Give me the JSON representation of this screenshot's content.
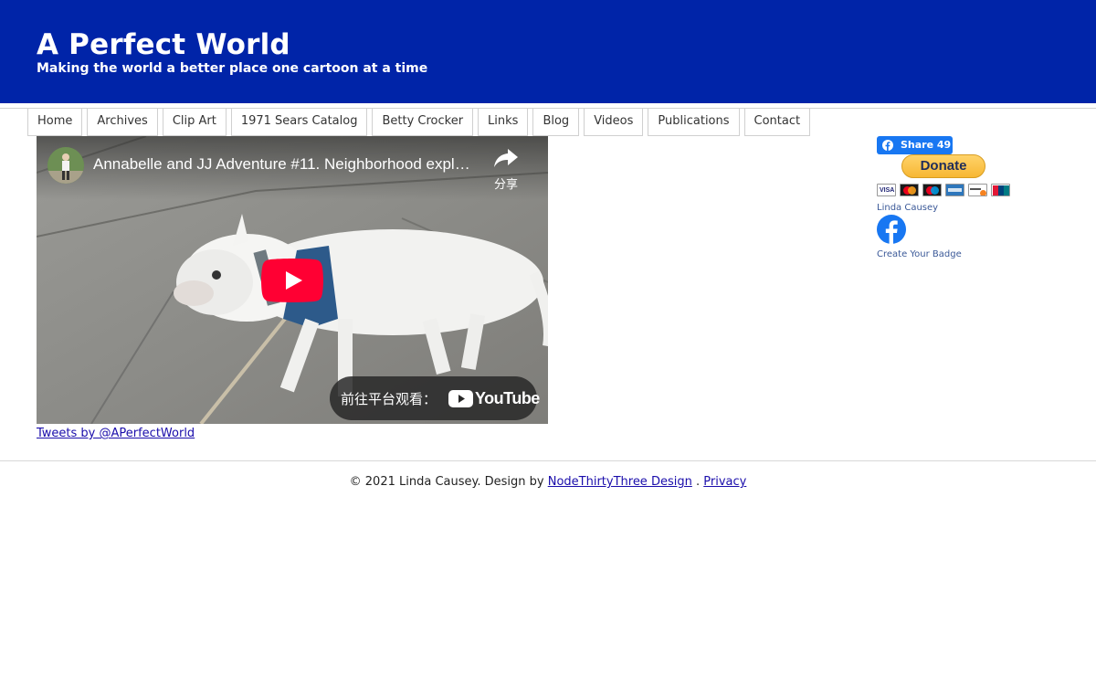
{
  "header": {
    "title": "A Perfect World",
    "tagline": "Making the world a better place one cartoon at a time",
    "background_color": "#0024a8"
  },
  "nav": {
    "items": [
      {
        "label": "Home"
      },
      {
        "label": "Archives"
      },
      {
        "label": "Clip Art"
      },
      {
        "label": "1971 Sears Catalog"
      },
      {
        "label": "Betty Crocker"
      },
      {
        "label": "Links"
      },
      {
        "label": "Blog"
      },
      {
        "label": "Videos"
      },
      {
        "label": "Publications"
      },
      {
        "label": "Contact"
      }
    ]
  },
  "video": {
    "title": "Annabelle and JJ Adventure #11. Neighborhood explore",
    "share_label": "分享",
    "watch_on_label": "前往平台观看：",
    "youtube_label": "YouTube",
    "play_color": "#ff0033"
  },
  "twitter": {
    "link_text": "Tweets by @APerfectWorld"
  },
  "sidebar": {
    "fb_share_label": "Share 49",
    "donate_label": "Donate",
    "cards": [
      "visa-card-icon",
      "mastercard-icon",
      "maestro-icon",
      "amex-icon",
      "discover-icon",
      "unionpay-icon"
    ],
    "badge_name": "Linda Causey",
    "create_badge_label": "Create Your Badge",
    "facebook_color": "#1877f2"
  },
  "footer": {
    "copyright": "© 2021 Linda Causey. Design by",
    "design_link": "NodeThirtyThree Design",
    "separator": ".",
    "privacy_link": "Privacy"
  }
}
